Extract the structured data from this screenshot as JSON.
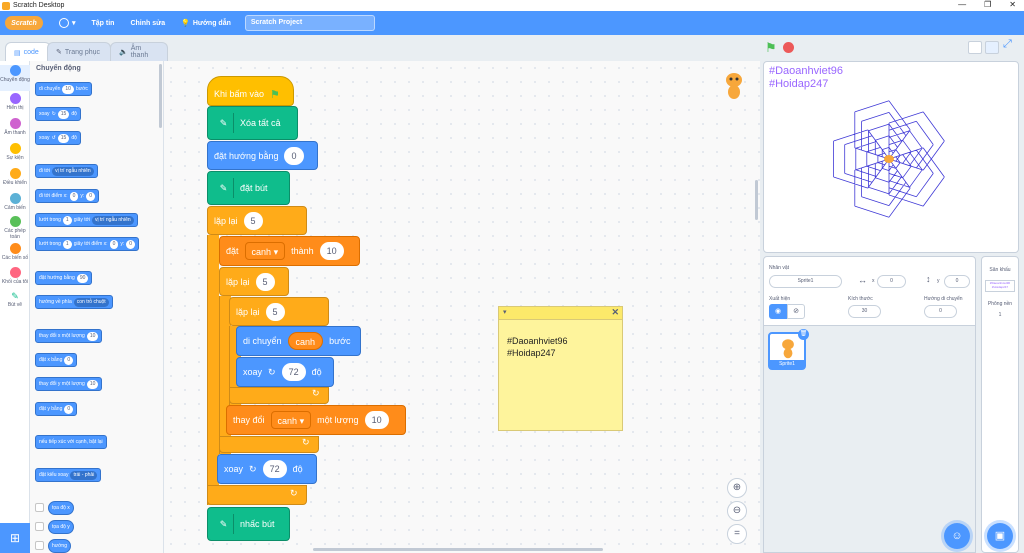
{
  "window": {
    "title": "Scratch Desktop",
    "controls": [
      "—",
      "❐",
      "✕"
    ]
  },
  "menu": {
    "logo": "Scratch",
    "file": "Tập tin",
    "edit": "Chỉnh sửa",
    "tutorials": "Hướng dẫn",
    "project_name": "Scratch Project"
  },
  "tabs": [
    {
      "label": "code"
    },
    {
      "label": "Trang phục"
    },
    {
      "label": "Âm thanh"
    }
  ],
  "categories": [
    {
      "label": "Chuyển động",
      "color": "#4c97ff"
    },
    {
      "label": "Hiển thị",
      "color": "#9966ff"
    },
    {
      "label": "Âm thanh",
      "color": "#cf63cf"
    },
    {
      "label": "Sự kiện",
      "color": "#ffbf00"
    },
    {
      "label": "Điều khiển",
      "color": "#ffab19"
    },
    {
      "label": "Cảm biến",
      "color": "#5cb1d6"
    },
    {
      "label": "Các phép toán",
      "color": "#59c059"
    },
    {
      "label": "Các biến số",
      "color": "#ff8c1a"
    },
    {
      "label": "Khối của tôi",
      "color": "#ff6680"
    },
    {
      "label": "Bút vẽ",
      "color": "#0fbd8c"
    }
  ],
  "palette": {
    "title": "Chuyển động",
    "move": "di chuyển",
    "move_val": "10",
    "move_unit": "bước",
    "turn_r": "xoay",
    "turn_r_val": "15",
    "turn_r_unit": "độ",
    "turn_l": "xoay",
    "turn_l_val": "15",
    "turn_l_unit": "độ",
    "goto": "đi tới",
    "goto_dd": "vị trí ngẫu nhiên",
    "gotoxy": "đi tới điểm x:",
    "gotoxy_x": "0",
    "gotoxy_y_lbl": "y:",
    "gotoxy_y": "0",
    "glide": "lướt trong",
    "glide_val": "1",
    "glide_unit": "giây tới",
    "glide_dd": "vị trí ngẫu nhiên",
    "glidexy": "lướt trong",
    "glidexy_val": "1",
    "glidexy_unit": "giây tới điểm x:",
    "glidexy_x": "0",
    "glidexy_y_lbl": "y:",
    "glidexy_y": "0",
    "point": "đặt hướng bằng",
    "point_val": "90",
    "pointto": "hướng về phía",
    "pointto_dd": "con trỏ chuột",
    "changex": "thay đổi x một lượng",
    "changex_val": "10",
    "setx": "đặt x bằng",
    "setx_val": "0",
    "changey": "thay đổi y một lượng",
    "changey_val": "10",
    "sety": "đặt y bằng",
    "sety_val": "0",
    "bounce": "nếu tiếp xúc với cạnh, bật lại",
    "rotstyle": "đặt kiểu xoay",
    "rotstyle_dd": "trái - phải",
    "xpos": "tọa độ x",
    "ypos": "tọa độ y",
    "dir": "hướng"
  },
  "script": {
    "hat": "Khi bấm vào",
    "clear": "Xóa tất cả",
    "point": "đặt hướng bằng",
    "point_val": "0",
    "pendown": "đặt bút",
    "repeat1": "lặp lại",
    "repeat1_val": "5",
    "set": "đặt",
    "set_var": "canh",
    "set_to": "thành",
    "set_val": "10",
    "repeat2": "lặp lại",
    "repeat2_val": "5",
    "repeat3": "lặp lại",
    "repeat3_val": "5",
    "move": "di chuyển",
    "move_var": "canh",
    "move_unit": "bước",
    "turn": "xoay",
    "turn_val": "72",
    "turn_unit": "độ",
    "change": "thay đổi",
    "change_var": "canh",
    "change_by": "một lượng",
    "change_val": "10",
    "turn2": "xoay",
    "turn2_val": "72",
    "turn2_unit": "độ",
    "penup": "nhấc bút"
  },
  "note": {
    "line1": "#Daoanhviet96",
    "line2": "#Hoidap247"
  },
  "stage": {
    "line1": "#Daoanhviet96",
    "line2": "#Hoidap247"
  },
  "sprite_info": {
    "sprite_lbl": "Nhân vật",
    "sprite_name": "Sprite1",
    "x_lbl": "x",
    "x_val": "0",
    "y_lbl": "y",
    "y_val": "0",
    "show_lbl": "Xuất hiện",
    "size_lbl": "Kích thước",
    "size_val": "30",
    "dir_lbl": "Hướng di chuyển",
    "dir_val": "0"
  },
  "sprite_tile": {
    "name": "Sprite1"
  },
  "backdrop": {
    "title": "Sân khấu",
    "count_lbl": "Phông nền",
    "count": "1"
  },
  "colors": {
    "accent": "#4c97ff",
    "events": "#ffbf00",
    "control": "#ffab19",
    "pen": "#0fbd8c",
    "variables": "#ff8c1a",
    "say": "#9966ff"
  }
}
